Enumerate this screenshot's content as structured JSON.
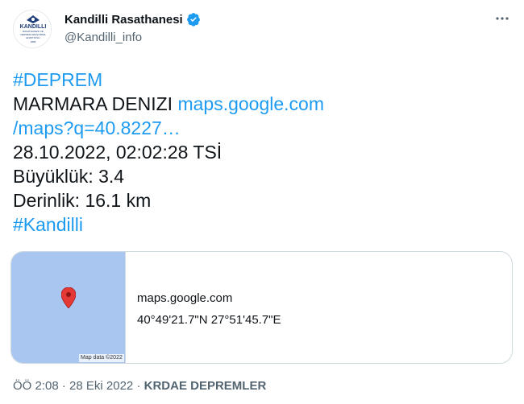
{
  "user": {
    "name": "Kandilli Rasathanesi",
    "handle": "@Kandilli_info",
    "avatar_lines": [
      "KANDILLI",
      "RASATHANESI VE",
      "DEPREM ARAŞTIRMA",
      "ENSTİTÜSÜ",
      "1868"
    ]
  },
  "tweet": {
    "hashtag1": "#DEPREM",
    "location": "MARMARA DENIZI",
    "link_domain": "maps.google.com",
    "link_path": "/maps?q=40.8227…",
    "datetime": "28.10.2022, 02:02:28 TSİ",
    "magnitude": "Büyüklük: 3.4",
    "depth": "Derinlik: 16.1 km",
    "hashtag2": "#Kandilli"
  },
  "card": {
    "map_credit": "Map data ©2022",
    "domain": "maps.google.com",
    "coordinates": "40°49'21.7\"N 27°51'45.7\"E"
  },
  "meta": {
    "time": "ÖÖ 2:08",
    "date": "28 Eki 2022",
    "separator": " · ",
    "source": "KRDAE DEPREMLER"
  },
  "colors": {
    "accent": "#1d9bf0",
    "secondary_text": "#536471",
    "map_water": "#a8c6ef",
    "pin": "#e53935"
  },
  "icons": [
    "verified-badge-icon",
    "more-options-icon",
    "map-pin-icon"
  ]
}
